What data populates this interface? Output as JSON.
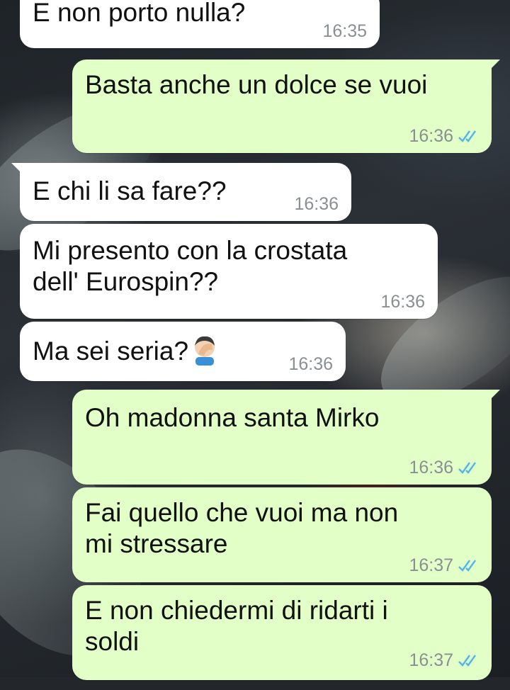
{
  "messages": [
    {
      "direction": "in",
      "text": "E non porto nulla?",
      "time": "16:35"
    },
    {
      "direction": "out",
      "text": "Basta anche un dolce se vuoi",
      "time": "16:36",
      "status": "read"
    },
    {
      "direction": "in",
      "text": "E chi li sa fare??",
      "time": "16:36"
    },
    {
      "direction": "in",
      "text": "Mi presento con la crostata\ndell' Eurospin??",
      "time": "16:36"
    },
    {
      "direction": "in",
      "text": "Ma sei seria?",
      "emoji": "man-facepalming-emoji",
      "time": "16:36"
    },
    {
      "direction": "out",
      "text": "Oh madonna santa Mirko",
      "time": "16:36",
      "status": "read"
    },
    {
      "direction": "out",
      "text": "Fai quello che vuoi ma non\nmi stressare",
      "time": "16:37",
      "status": "read"
    },
    {
      "direction": "out",
      "text": "E non chiedermi di ridarti i\nsoldi",
      "time": "16:37",
      "status": "read"
    }
  ],
  "colors": {
    "incoming_bubble": "#ffffff",
    "outgoing_bubble": "#e2ffc8",
    "read_ticks": "#4fb6ec",
    "timestamp": "#8a8f93"
  }
}
